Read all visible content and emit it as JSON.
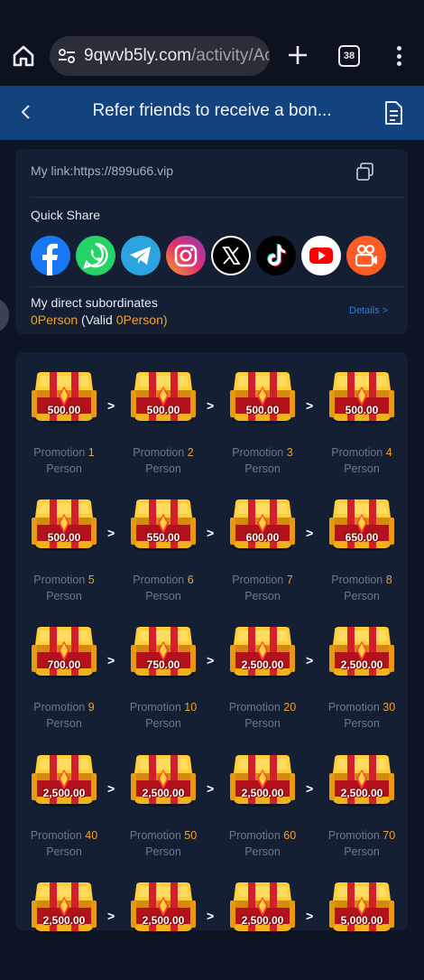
{
  "browser": {
    "tab_count": "38",
    "url_host": "9qwvb5ly.com",
    "url_path": "/activity/Ac"
  },
  "header": {
    "title": "Refer friends to receive a bon..."
  },
  "share": {
    "link_label": "My link:",
    "link_url": "https://899u66.vip",
    "quick_share_label": "Quick Share",
    "socials": [
      "facebook",
      "whatsapp",
      "telegram",
      "instagram",
      "x",
      "tiktok",
      "youtube",
      "kwai"
    ],
    "subordinates_label": "My direct subordinates",
    "count": "0",
    "person_word": "Person",
    "valid_open": " (Valid ",
    "valid_count": "0",
    "valid_close": "Person)",
    "details_label": "Details >"
  },
  "tiers": {
    "promotion_word": "Promotion",
    "person_word": "Person",
    "arrow": ">",
    "items": [
      {
        "amount": "500.00",
        "persons": "1"
      },
      {
        "amount": "500.00",
        "persons": "2"
      },
      {
        "amount": "500.00",
        "persons": "3"
      },
      {
        "amount": "500.00",
        "persons": "4"
      },
      {
        "amount": "500.00",
        "persons": "5"
      },
      {
        "amount": "550.00",
        "persons": "6"
      },
      {
        "amount": "600.00",
        "persons": "7"
      },
      {
        "amount": "650.00",
        "persons": "8"
      },
      {
        "amount": "700.00",
        "persons": "9"
      },
      {
        "amount": "750.00",
        "persons": "10"
      },
      {
        "amount": "2,500.00",
        "persons": "20"
      },
      {
        "amount": "2,500.00",
        "persons": "30"
      },
      {
        "amount": "2,500.00",
        "persons": "40"
      },
      {
        "amount": "2,500.00",
        "persons": "50"
      },
      {
        "amount": "2,500.00",
        "persons": "60"
      },
      {
        "amount": "2,500.00",
        "persons": "70"
      },
      {
        "amount": "2,500.00",
        "persons": ""
      },
      {
        "amount": "2,500.00",
        "persons": ""
      },
      {
        "amount": "2,500.00",
        "persons": ""
      },
      {
        "amount": "5,000.00",
        "persons": ""
      }
    ]
  }
}
